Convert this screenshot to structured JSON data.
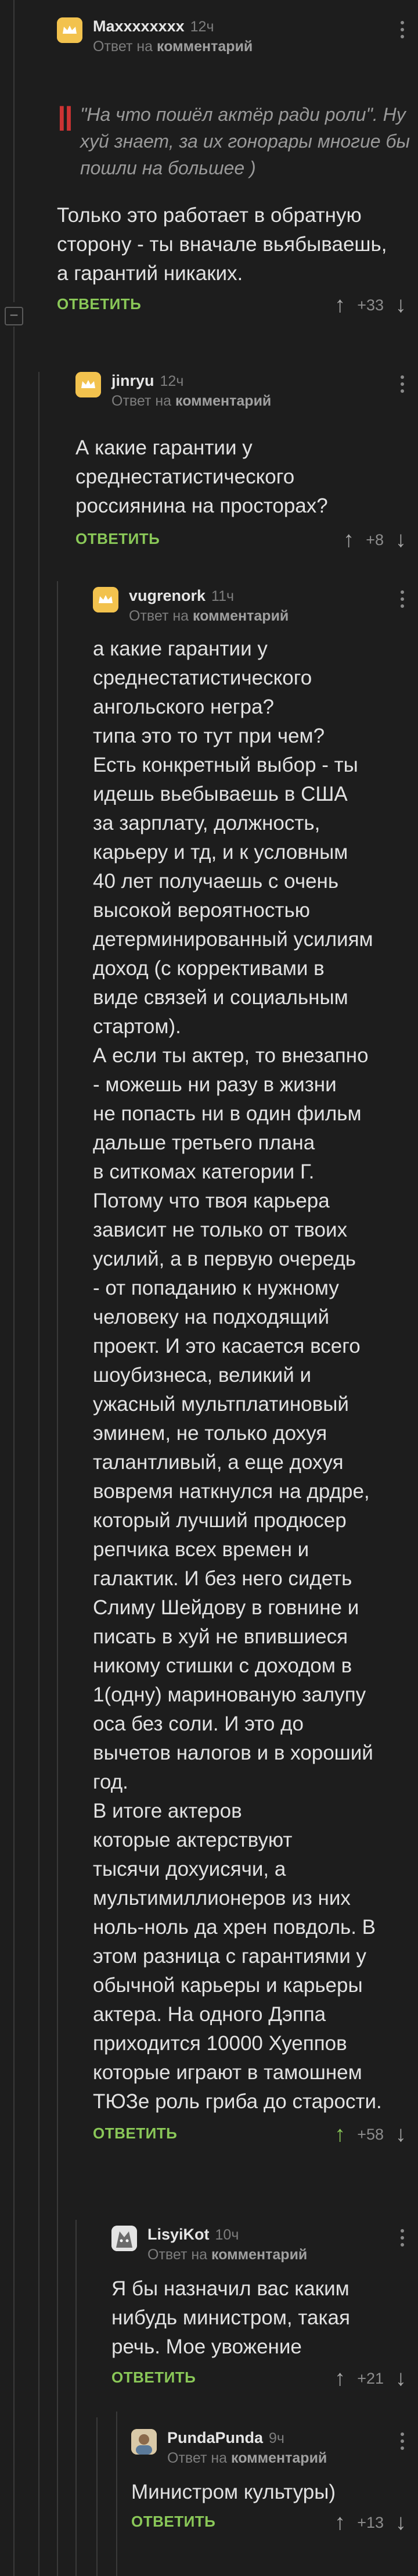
{
  "comments": [
    {
      "author": "Maxxxxxxxx",
      "time": "12ч",
      "reply_prefix": "Ответ на",
      "reply_target": "комментарий",
      "quote": "\"На что пошёл актёр ради роли\". Ну хуй знает, за их гонорары многие бы пошли на большее )",
      "text": "Только это работает в обратную сторону - ты вначале вьябываешь, а гарантий никаких.",
      "reply_label": "ОТВЕТИТЬ",
      "score": "+33"
    },
    {
      "author": "jinryu",
      "time": "12ч",
      "reply_prefix": "Ответ на",
      "reply_target": "комментарий",
      "text": "А какие гарантии у среднестатистического россиянина на просторах?",
      "reply_label": "ОТВЕТИТЬ",
      "score": "+8"
    },
    {
      "author": "vugrenork",
      "time": "11ч",
      "reply_prefix": "Ответ на",
      "reply_target": "комментарий",
      "text": "а какие гарантии у\nсреднестатистического\nангольского негра?\nтипа это то тут при чем?\nЕсть конкретный выбор - ты\nидешь вьебываешь в США\nза зарплату, должность,\nкарьеру и тд, и к условным\n40 лет получаешь с очень\nвысокой вероятностью\nдетерминированный усилиям\nдоход (с коррективами в\nвиде связей и социальным\nстартом).\nА если ты актер, то внезапно\n- можешь ни разу в жизни\nне попасть ни в один фильм\nдальше третьего плана\nв ситкомах категории Г.\nПотому что твоя карьера\nзависит не только от твоих\nусилий, а в первую очередь\n- от попаданию к нужному\nчеловеку на подходящий\nпроект. И это касается всего\nшоубизнеса, великий и\nужасный мультплатиновый\nэминем, не только дохуя\nталантливый, а еще дохуя\nвовремя наткнулся на дрдре,\nкоторый лучший продюсер\nрепчика всех времен и\nгалактик. И без него сидеть\nСлиму Шейдову в говнине и\nписать в хуй не впившиеся\nникому стишки с доходом в\n1(одну) маринованую залупу\nоса без соли. И это до\nвычетов налогов и в хороший\nгод.\nВ итоге актеров\nкоторые актерствуют\nтысячи дохуисячи, а\nмультимиллионеров из них\nноль-ноль да хрен повдоль. В\nэтом разница с гарантиями у\nобычной карьеры и карьеры\nактера. На одного Дэппа\nприходится 10000 Хуеппов\nкоторые играют в тамошнем\nТЮЗе роль гриба до старости.",
      "reply_label": "ОТВЕТИТЬ",
      "score": "+58"
    },
    {
      "author": "LisyiKot",
      "time": "10ч",
      "reply_prefix": "Ответ на",
      "reply_target": "комментарий",
      "text": "Я бы назначил вас каким\nнибудь министром, такая\nречь. Мое увожение",
      "reply_label": "ОТВЕТИТЬ",
      "score": "+21"
    },
    {
      "author": "PundaPunda",
      "time": "9ч",
      "reply_prefix": "Ответ на",
      "reply_target": "комментарий",
      "text": "Министром культуры)",
      "reply_label": "ОТВЕТИТЬ",
      "score": "+13"
    }
  ],
  "icons": {
    "up": "arrow-up-icon",
    "down": "arrow-down-icon",
    "menu": "more-vertical-icon",
    "collapse": "collapse-minus-icon"
  },
  "colors": {
    "background": "#1d1d1d",
    "reply": "#8ac858",
    "quote_mark": "#cc3333"
  }
}
